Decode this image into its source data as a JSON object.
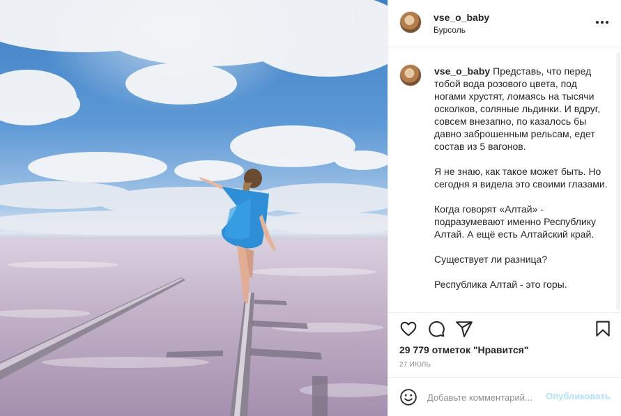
{
  "post": {
    "username": "vse_o_baby",
    "location": "Бурсоль"
  },
  "caption": {
    "username": "vse_o_baby",
    "paragraphs": [
      "Представь, что перед тобой вода розового цвета, под ногами хрустят, ломаясь на тысячи осколков, соляные льдинки. И вдруг, совсем внезапно, по казалось бы давно заброшенным рельсам, едет состав из 5 вагонов.",
      "Я не знаю, как такое может быть. Но сегодня я видела это своими глазами.",
      "Когда говорят «Алтай» - подразумевают именно Республику Алтай. А ещё есть Алтайский край.",
      "Существует ли разница?",
      "Республика Алтай - это горы."
    ]
  },
  "likes_text": "29 779 отметок \"Нравится\"",
  "date": "27 ИЮЛЬ",
  "comment": {
    "placeholder": "Добавьте комментарий...",
    "publish_label": "Опубликовать"
  },
  "icons": {
    "more": "more-options-icon",
    "like": "heart-icon",
    "comment": "speech-bubble-icon",
    "share": "paper-plane-icon",
    "save": "bookmark-icon",
    "emoji": "smiley-icon"
  },
  "colors": {
    "text": "#262626",
    "secondary_text": "#8e8e8e",
    "publish_disabled": "#b2dffc",
    "border": "#efefef"
  }
}
